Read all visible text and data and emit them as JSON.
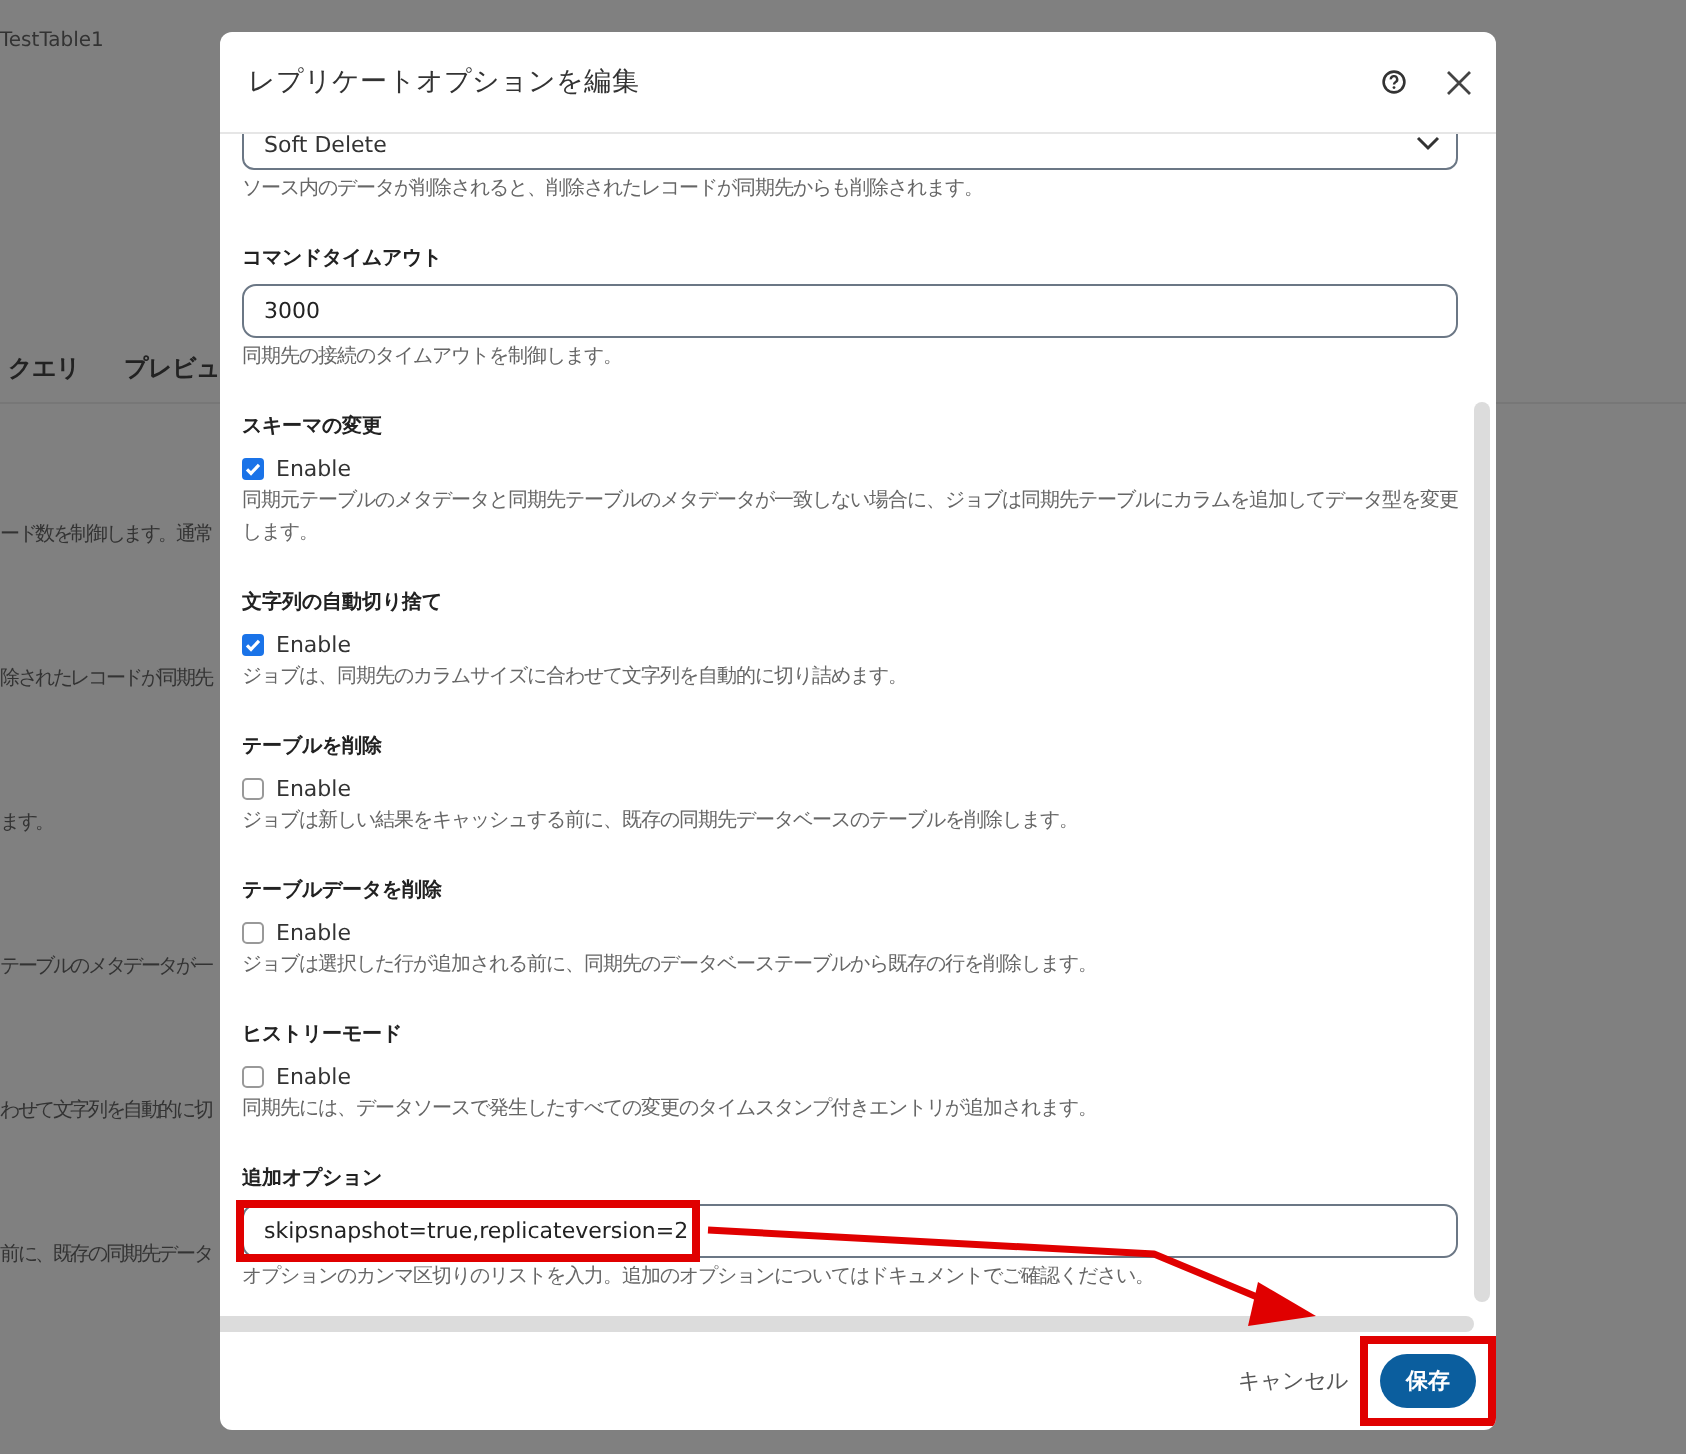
{
  "background": {
    "table_name": "TestTable1",
    "tabs": [
      {
        "label": "クエリ"
      },
      {
        "label": "プレビュ"
      }
    ],
    "descriptions": [
      "ード数を制御します。通常",
      "除されたレコードが同期先",
      "ます。",
      "テーブルのメタデータが一",
      "わせて文字列を自動的に切",
      "前に、既存の同期先データ"
    ]
  },
  "dialog": {
    "title": "レプリケートオプションを編集",
    "sections": [
      {
        "kind": "select",
        "value": "Soft Delete",
        "description": "ソース内のデータが削除されると、削除されたレコードが同期先からも削除されます。"
      },
      {
        "kind": "text",
        "label": "コマンドタイムアウト",
        "value": "3000",
        "highlighted": false,
        "description": "同期先の接続のタイムアウトを制御します。"
      },
      {
        "kind": "checkbox",
        "label": "スキーマの変更",
        "option": "Enable",
        "checked": true,
        "description": "同期元テーブルのメタデータと同期先テーブルのメタデータが一致しない場合に、ジョブは同期先テーブルにカラムを追加してデータ型を変更します。"
      },
      {
        "kind": "checkbox",
        "label": "文字列の自動切り捨て",
        "option": "Enable",
        "checked": true,
        "description": "ジョブは、同期先のカラムサイズに合わせて文字列を自動的に切り詰めます。"
      },
      {
        "kind": "checkbox",
        "label": "テーブルを削除",
        "option": "Enable",
        "checked": false,
        "description": "ジョブは新しい結果をキャッシュする前に、既存の同期先データベースのテーブルを削除します。"
      },
      {
        "kind": "checkbox",
        "label": "テーブルデータを削除",
        "option": "Enable",
        "checked": false,
        "description": "ジョブは選択した行が追加される前に、同期先のデータベーステーブルから既存の行を削除します。"
      },
      {
        "kind": "checkbox",
        "label": "ヒストリーモード",
        "option": "Enable",
        "checked": false,
        "description": "同期先には、データソースで発生したすべての変更のタイムスタンプ付きエントリが追加されます。"
      },
      {
        "kind": "text",
        "label": "追加オプション",
        "value": "skipsnapshot=true,replicateversion=2",
        "highlighted": true,
        "description": "オプションのカンマ区切りのリストを入力。追加のオプションについてはドキュメントでご確認ください。"
      }
    ],
    "buttons": [
      {
        "label": "キャンセル",
        "kind": "secondary",
        "highlighted": false
      },
      {
        "label": "保存",
        "kind": "primary",
        "highlighted": true
      }
    ]
  }
}
